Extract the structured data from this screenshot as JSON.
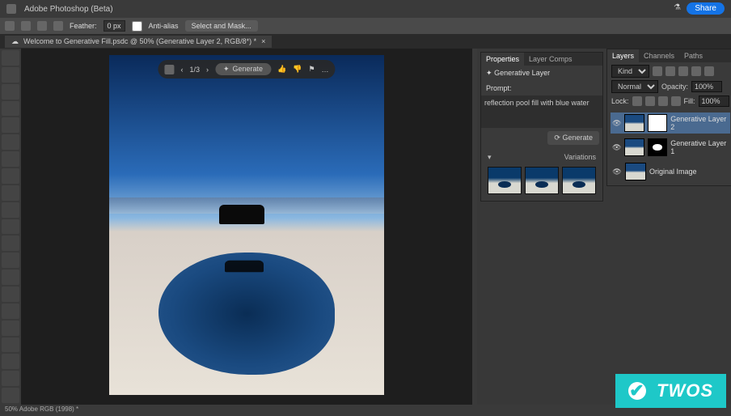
{
  "app": {
    "title": "Adobe Photoshop (Beta)",
    "share": "Share"
  },
  "options": {
    "feather_label": "Feather:",
    "feather_value": "0 px",
    "antialias": "Anti-alias",
    "select_mask": "Select and Mask..."
  },
  "doc_tab": {
    "name": "Welcome to Generative Fill.psdc @ 50% (Generative Layer 2, RGB/8*) *",
    "close": "×"
  },
  "gen_bar": {
    "nav_prev": "‹",
    "counter": "1/3",
    "nav_next": "›",
    "generate": "Generate",
    "thumbs_up": "👍",
    "thumbs_down": "👎",
    "flag": "⚑",
    "more": "…"
  },
  "properties": {
    "tabs": [
      "Properties",
      "Layer Comps"
    ],
    "active_tab": 0,
    "layer_type": "Generative Layer",
    "prompt_label": "Prompt:",
    "prompt_text": "reflection pool fill with blue water",
    "generate_btn": "Generate",
    "variations_label": "Variations"
  },
  "layers_panel": {
    "tabs": [
      "Layers",
      "Channels",
      "Paths"
    ],
    "active_tab": 0,
    "kind_label": "Kind",
    "blend_mode": "Normal",
    "opacity_label": "Opacity:",
    "opacity_value": "100%",
    "lock_label": "Lock:",
    "fill_label": "Fill:",
    "fill_value": "100%",
    "layers": [
      {
        "name": "Generative Layer 2",
        "has_mask": true,
        "mask_kind": "full",
        "active": true
      },
      {
        "name": "Generative Layer 1",
        "has_mask": true,
        "mask_kind": "spot",
        "active": false
      },
      {
        "name": "Original Image",
        "has_mask": false,
        "active": false
      }
    ]
  },
  "status": {
    "text": "50%    Adobe RGB (1998) *"
  },
  "watermark": {
    "text": "TWOS"
  }
}
